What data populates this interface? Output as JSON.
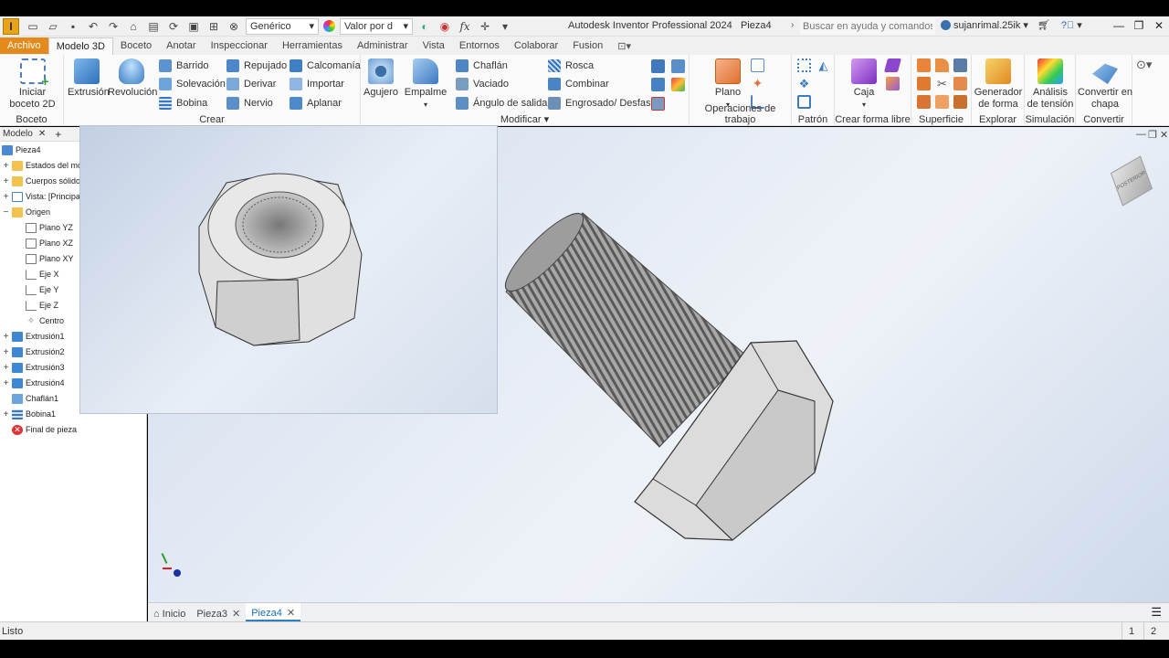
{
  "app": {
    "logo": "I",
    "title": "Autodesk Inventor Professional 2024",
    "document": "Pieza4",
    "search_placeholder": "Buscar en ayuda y comandos...",
    "user": "sujanrimal.25ik",
    "material": "Genérico",
    "appearance": "Valor por d"
  },
  "tabs": [
    "Archivo",
    "Modelo 3D",
    "Boceto",
    "Anotar",
    "Inspeccionar",
    "Herramientas",
    "Administrar",
    "Vista",
    "Entornos",
    "Colaborar",
    "Fusion"
  ],
  "ribbon": {
    "boceto": {
      "start_line1": "Iniciar",
      "start_line2": "boceto 2D",
      "label": "Boceto"
    },
    "crear": {
      "extrusion": "Extrusión",
      "revolucion": "Revolución",
      "barrido": "Barrido",
      "solevacion": "Solevación",
      "bobina": "Bobina",
      "repujado": "Repujado",
      "derivar": "Derivar",
      "nervio": "Nervio",
      "calcomania": "Calcomanía",
      "importar": "Importar",
      "aplanar": "Aplanar",
      "label": "Crear"
    },
    "modificar": {
      "agujero": "Agujero",
      "empalme": "Empalme",
      "chaflan": "Chaflán",
      "vaciado": "Vaciado",
      "angulo": "Ángulo de salida",
      "rosca": "Rosca",
      "combinar": "Combinar",
      "engrosado": "Engrosado/ Desfase",
      "label": "Modificar"
    },
    "trabajo": {
      "plano": "Plano",
      "label": "Operaciones de trabajo"
    },
    "patron": {
      "label": "Patrón"
    },
    "libre": {
      "caja": "Caja",
      "label": "Crear forma libre"
    },
    "superficie": {
      "label": "Superficie"
    },
    "explorar": {
      "gen1": "Generador",
      "gen2": "de forma",
      "label": "Explorar"
    },
    "simulacion": {
      "an1": "Análisis",
      "an2": "de tensión",
      "label": "Simulación"
    },
    "convertir": {
      "c1": "Convertir en",
      "c2": "chapa",
      "label": "Convertir"
    }
  },
  "browser": {
    "tab": "Modelo",
    "root": "Pieza4",
    "items": [
      "Estados del mo",
      "Cuerpos sólido",
      "Vista: [Principa",
      "Origen",
      "Plano YZ",
      "Plano XZ",
      "Plano XY",
      "Eje X",
      "Eje Y",
      "Eje Z",
      "Centro",
      "Extrusión1",
      "Extrusión2",
      "Extrusión3",
      "Extrusión4",
      "Chaflán1",
      "Bobina1",
      "Final de pieza"
    ]
  },
  "doc_tabs": [
    "Inicio",
    "Pieza3",
    "Pieza4"
  ],
  "status": {
    "text": "Listo",
    "n1": "1",
    "n2": "2"
  },
  "viewcube": {
    "label": "POSTERIOR"
  },
  "colors": {
    "accent": "#e58a1a",
    "tab_active": "#2f7fc2",
    "viewport_top": "#d2ddee"
  }
}
